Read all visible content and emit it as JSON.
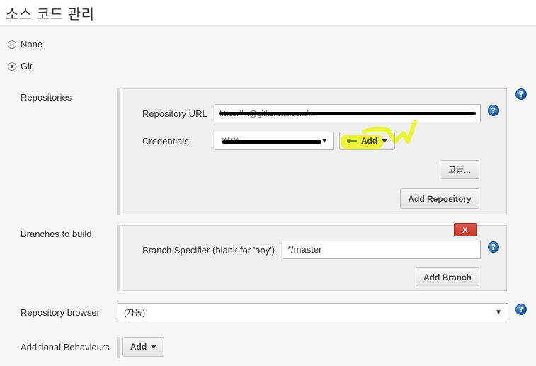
{
  "page": {
    "title": "소스 코드 관리"
  },
  "scm_options": [
    {
      "label": "None",
      "selected": false
    },
    {
      "label": "Git",
      "selected": true
    }
  ],
  "repositories": {
    "section_label": "Repositories",
    "url_label": "Repository URL",
    "url_value": "https://...@gitkorea...com/...",
    "credentials_label": "Credentials",
    "credentials_value": "******",
    "add_label": "Add",
    "advanced_label": "고급...",
    "add_repository_label": "Add Repository"
  },
  "branches": {
    "section_label": "Branches to build",
    "remove_label": "X",
    "specifier_label": "Branch Specifier (blank for 'any')",
    "specifier_value": "*/master",
    "add_branch_label": "Add Branch"
  },
  "browser": {
    "section_label": "Repository browser",
    "selected_value": "(자동)"
  },
  "behaviours": {
    "section_label": "Additional Behaviours",
    "add_label": "Add"
  },
  "help_icon_glyph": "?",
  "colors": {
    "help_icon": "#1b5aa6",
    "delete_button": "#d9473b",
    "highlight": "#ebf514"
  }
}
